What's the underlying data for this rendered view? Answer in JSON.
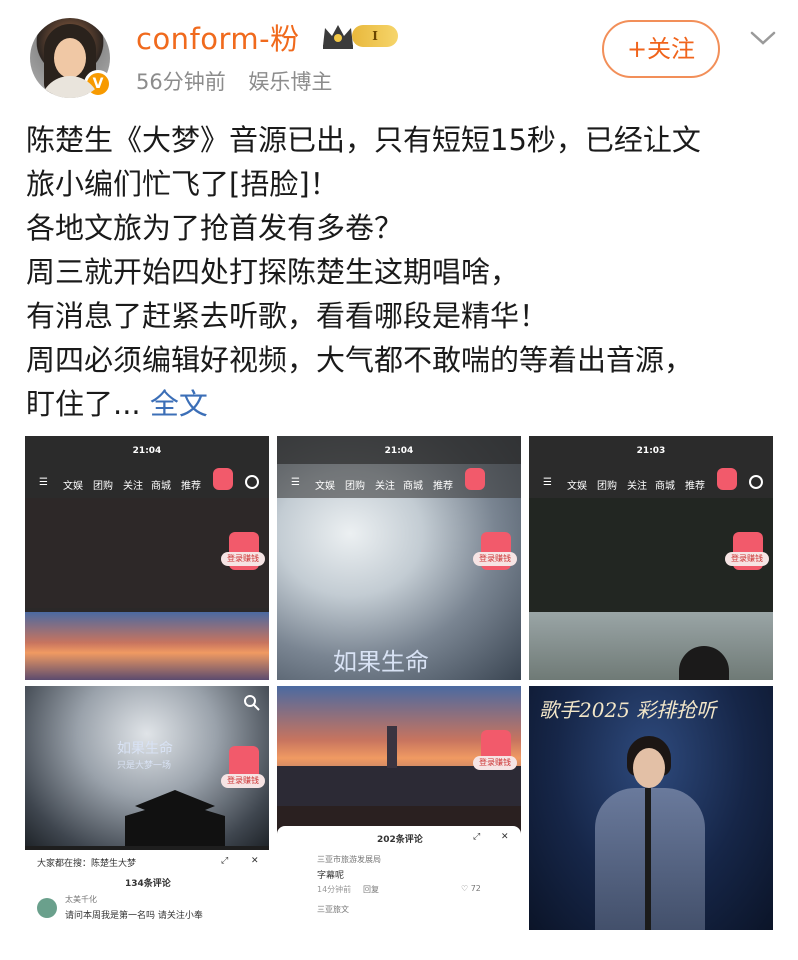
{
  "header": {
    "username": "conform-粉",
    "level": "I",
    "time": "56分钟前",
    "role": "娱乐博主",
    "follow_label": "+关注",
    "verify_mark": "V"
  },
  "post": {
    "lines": [
      "陈楚生《大梦》音源已出，只有短短15秒，已经让文",
      "旅小编们忙飞了[捂脸]！",
      "各地文旅为了抢首发有多卷？",
      "周三就开始四处打探陈楚生这期唱啥，",
      "有消息了赶紧去听歌，看看哪段是精华！",
      "周四必须编辑好视频，大气都不敢喘的等着出音源，"
    ],
    "last_line": "盯住了...",
    "fulltext_label": "全文"
  },
  "images": {
    "img1": {
      "time": "21:04",
      "nav": [
        "文娱",
        "团购",
        "关注",
        "商城",
        "推荐"
      ],
      "redbag_label": "登录赚钱"
    },
    "img2": {
      "time": "21:04",
      "nav": [
        "文娱",
        "团购",
        "关注",
        "商城",
        "推荐"
      ],
      "redbag_label": "登录赚钱",
      "caption": "如果生命"
    },
    "img3": {
      "time": "21:03",
      "nav": [
        "文娱",
        "团购",
        "关注",
        "商城",
        "推荐"
      ],
      "redbag_label": "登录赚钱"
    },
    "img4": {
      "caption": "如果生命",
      "caption2": "只是大梦一场",
      "redbag_label": "登录赚钱",
      "search_text": "大家都在搜：陈楚生大梦",
      "comment_count": "134条评论",
      "commenter": "太美千化",
      "comment": "请问本周我是第一名吗 请关注小奉"
    },
    "img5": {
      "redbag_label": "登录赚钱",
      "comment_count": "202条评论",
      "commenter": "三亚市旅游发展局",
      "comment": "字幕呢",
      "comment_date": "14分钟前",
      "reply_label": "回复",
      "likes": "72",
      "commenter2": "三亚旅文"
    },
    "img6": {
      "title_art": "歌手2025 彩排抢听"
    }
  },
  "colors": {
    "username": "#f06a1d",
    "follow": "#f0641c",
    "link": "#3c6fb7",
    "meta": "#8c8c8c"
  }
}
